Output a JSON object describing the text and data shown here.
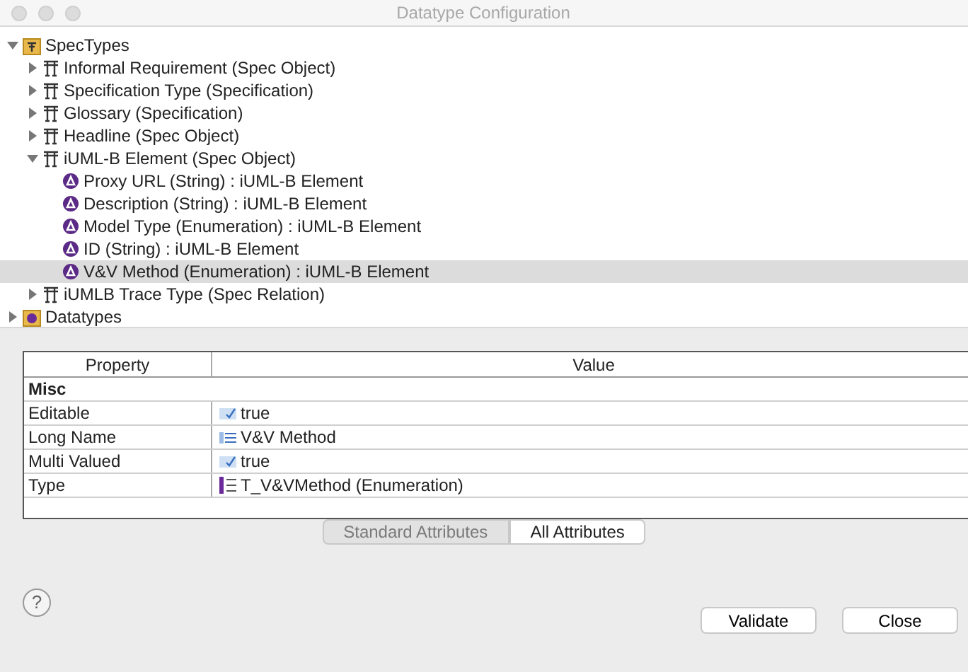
{
  "window": {
    "title": "Datatype Configuration"
  },
  "tree": [
    {
      "label": "SpecTypes",
      "kind": "spec-folder",
      "expanded": true,
      "selected": false,
      "children": [
        {
          "label": "Informal Requirement (Spec Object)",
          "kind": "type",
          "expanded": false,
          "selected": false
        },
        {
          "label": "Specification Type (Specification)",
          "kind": "type",
          "expanded": false,
          "selected": false
        },
        {
          "label": "Glossary (Specification)",
          "kind": "type",
          "expanded": false,
          "selected": false
        },
        {
          "label": "Headline (Spec Object)",
          "kind": "type",
          "expanded": false,
          "selected": false
        },
        {
          "label": "iUML-B Element (Spec Object)",
          "kind": "type",
          "expanded": true,
          "selected": false,
          "children": [
            {
              "label": "Proxy URL (String) : iUML-B Element",
              "kind": "attribute",
              "selected": false
            },
            {
              "label": "Description (String) : iUML-B Element",
              "kind": "attribute",
              "selected": false
            },
            {
              "label": "Model Type (Enumeration) : iUML-B Element",
              "kind": "attribute",
              "selected": false
            },
            {
              "label": "ID (String) : iUML-B Element",
              "kind": "attribute",
              "selected": false
            },
            {
              "label": "V&V Method (Enumeration) : iUML-B Element",
              "kind": "attribute",
              "selected": true
            }
          ]
        },
        {
          "label": "iUMLB Trace Type (Spec Relation)",
          "kind": "type",
          "expanded": false,
          "selected": false
        }
      ]
    },
    {
      "label": "Datatypes",
      "kind": "datatype-folder",
      "expanded": false,
      "selected": false
    }
  ],
  "properties": {
    "columns": [
      "Property",
      "Value"
    ],
    "category": "Misc",
    "rows": [
      {
        "property": "Editable",
        "value": "true",
        "kind": "boolean"
      },
      {
        "property": "Long Name",
        "value": "V&V Method",
        "kind": "text"
      },
      {
        "property": "Multi Valued",
        "value": "true",
        "kind": "boolean"
      },
      {
        "property": "Type",
        "value": "T_V&VMethod (Enumeration)",
        "kind": "enumeration"
      }
    ]
  },
  "tabs": [
    {
      "label": "Standard Attributes",
      "selected": false
    },
    {
      "label": "All Attributes",
      "selected": true
    }
  ],
  "help": {
    "label": "?"
  },
  "buttons": [
    "Validate",
    "Close"
  ]
}
